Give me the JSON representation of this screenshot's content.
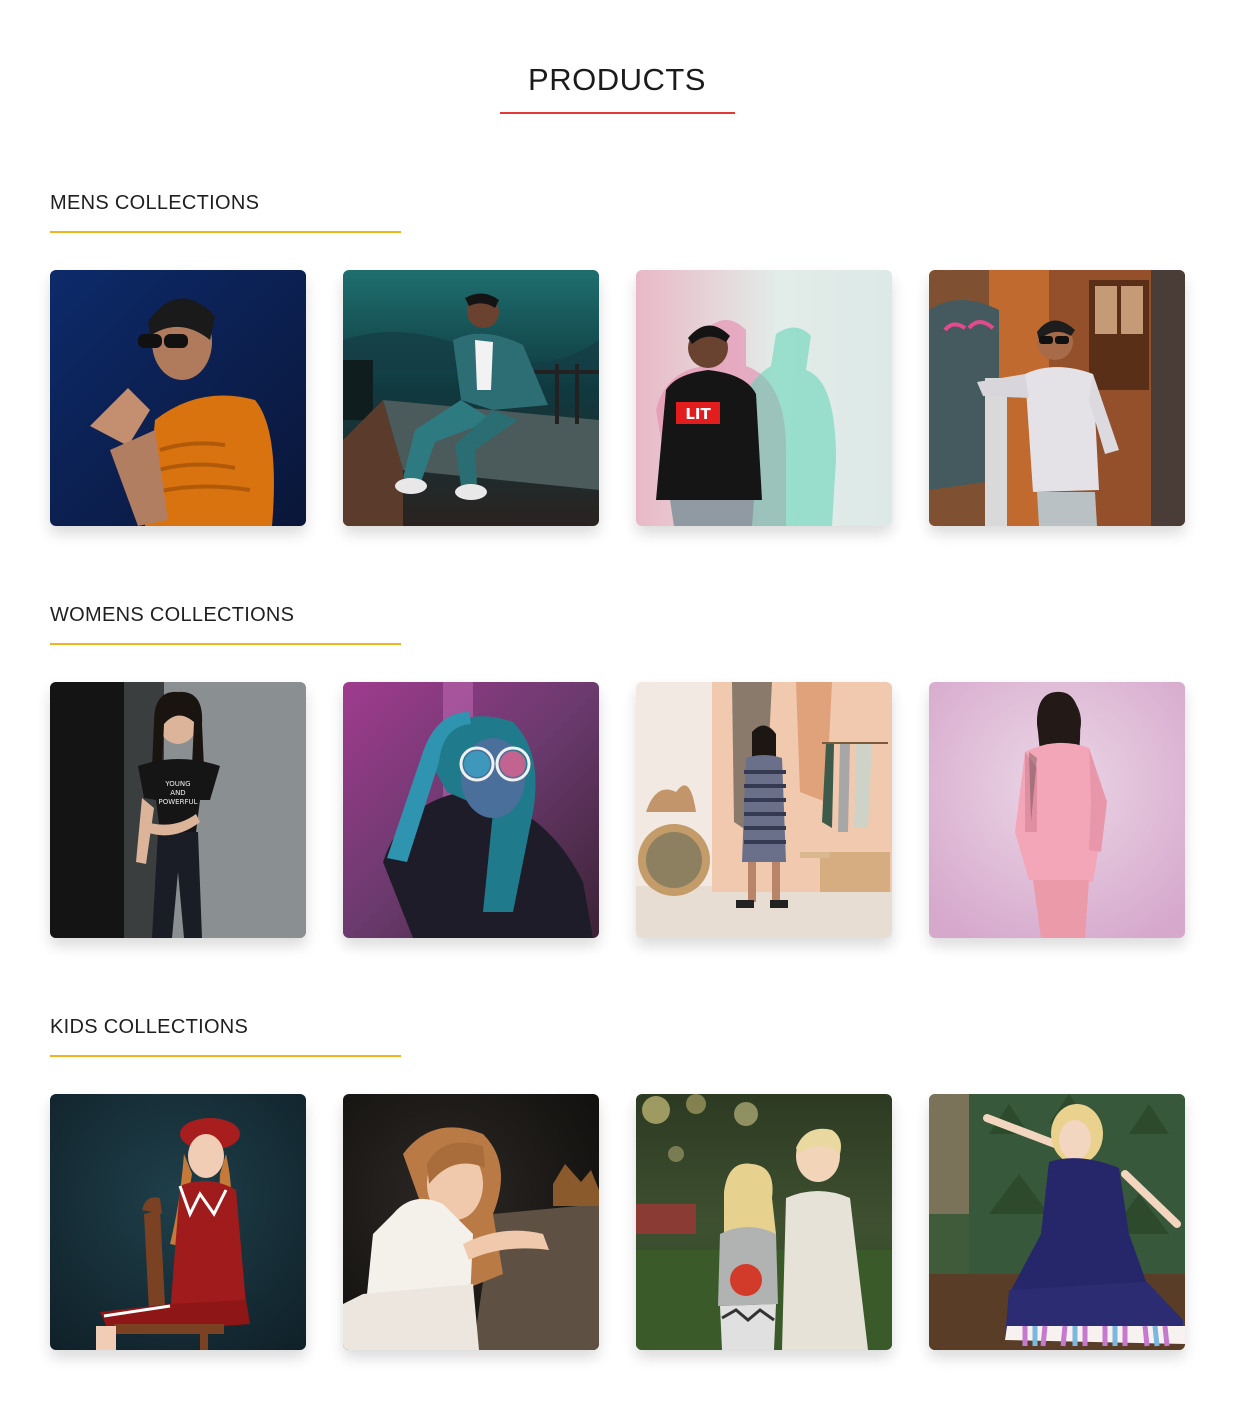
{
  "page": {
    "title": "PRODUCTS",
    "accent_color": "#e53935",
    "section_accent_color": "#f2b41c"
  },
  "sections": [
    {
      "title": "MENS COLLECTIONS",
      "products": [
        {
          "photo": "man-in-orange-sweater-with-sunglasses"
        },
        {
          "photo": "man-in-denim-jacket-sitting-on-ledge"
        },
        {
          "photo": "man-in-black-lit-sweatshirt"
        },
        {
          "photo": "man-in-white-sweater-by-wall"
        }
      ]
    },
    {
      "title": "WOMENS COLLECTIONS",
      "products": [
        {
          "photo": "woman-in-black-tshirt-young-and-powerful"
        },
        {
          "photo": "woman-with-glasses-in-neon-light"
        },
        {
          "photo": "woman-in-striped-dress-in-room"
        },
        {
          "photo": "woman-in-pink-suit"
        }
      ]
    },
    {
      "title": "KIDS COLLECTIONS",
      "products": [
        {
          "photo": "girl-in-red-coat-on-chair"
        },
        {
          "photo": "girl-in-white-dress-leaning-on-table"
        },
        {
          "photo": "two-kids-standing-outdoors"
        },
        {
          "photo": "girl-in-navy-dress-dancing"
        }
      ]
    }
  ]
}
